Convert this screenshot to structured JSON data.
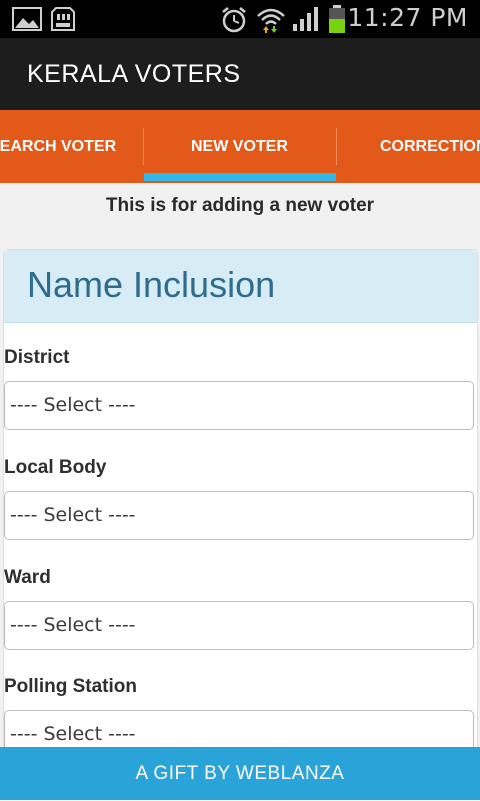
{
  "status_bar": {
    "time": "11:27 PM",
    "icons": [
      "gallery-icon",
      "sd-card-icon",
      "alarm-icon",
      "wifi-icon",
      "signal-icon",
      "battery-icon"
    ]
  },
  "app": {
    "title": "KERALA VOTERS"
  },
  "tabs": [
    {
      "label": "SEARCH VOTER",
      "selected": false
    },
    {
      "label": "NEW VOTER",
      "selected": true
    },
    {
      "label": "CORRECTION",
      "selected": false
    }
  ],
  "notice": "This is for adding a new voter",
  "form": {
    "title": "Name Inclusion",
    "fields": [
      {
        "label": "District",
        "value": "---- Select ----"
      },
      {
        "label": "Local Body",
        "value": "---- Select ----"
      },
      {
        "label": "Ward",
        "value": "---- Select ----"
      },
      {
        "label": "Polling Station",
        "value": "---- Select ----"
      }
    ]
  },
  "footer": {
    "label": "A GIFT BY WEBLANZA"
  },
  "colors": {
    "tab_bar": "#e2591a",
    "tab_indicator": "#33b5e5",
    "panel_header": "#d8ecf6",
    "panel_title": "#2d6b8f",
    "footer": "#2aa3d8"
  }
}
